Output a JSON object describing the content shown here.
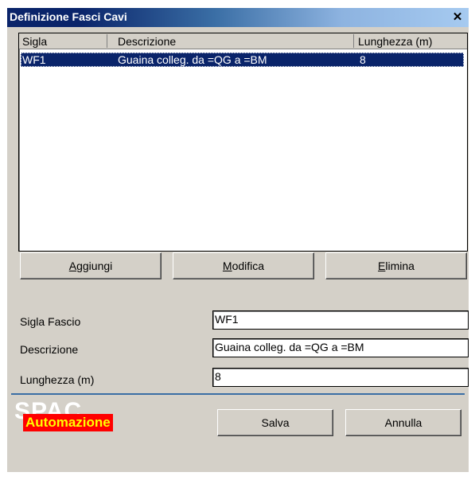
{
  "window": {
    "title": "Definizione Fasci Cavi",
    "close_symbol": "✕"
  },
  "list": {
    "columns": [
      "Sigla",
      "Descrizione",
      "Lunghezza (m)"
    ],
    "rows": [
      {
        "sigla": "WF1",
        "descrizione": "Guaina colleg. da =QG a =BM",
        "lunghezza": "8"
      }
    ]
  },
  "buttons": {
    "aggiungi": {
      "hotkey": "A",
      "rest": "ggiungi"
    },
    "modifica": {
      "hotkey": "M",
      "rest": "odifica"
    },
    "elimina": {
      "hotkey": "E",
      "rest": "limina"
    },
    "salva": "Salva",
    "annulla": "Annulla"
  },
  "form": {
    "sigla_label": "Sigla Fascio",
    "sigla_value": "WF1",
    "descrizione_label": "Descrizione",
    "descrizione_value": "Guaina colleg. da =QG a =BM",
    "lunghezza_label": "Lunghezza (m)",
    "lunghezza_value": "8"
  },
  "logo": {
    "top_text": "SPAC",
    "bottom_text": "Automazione"
  },
  "colors": {
    "selection": "#0a246a",
    "divider": "#3a6ea5",
    "logo_bg": "#ff0000",
    "logo_text": "#ffff00"
  }
}
